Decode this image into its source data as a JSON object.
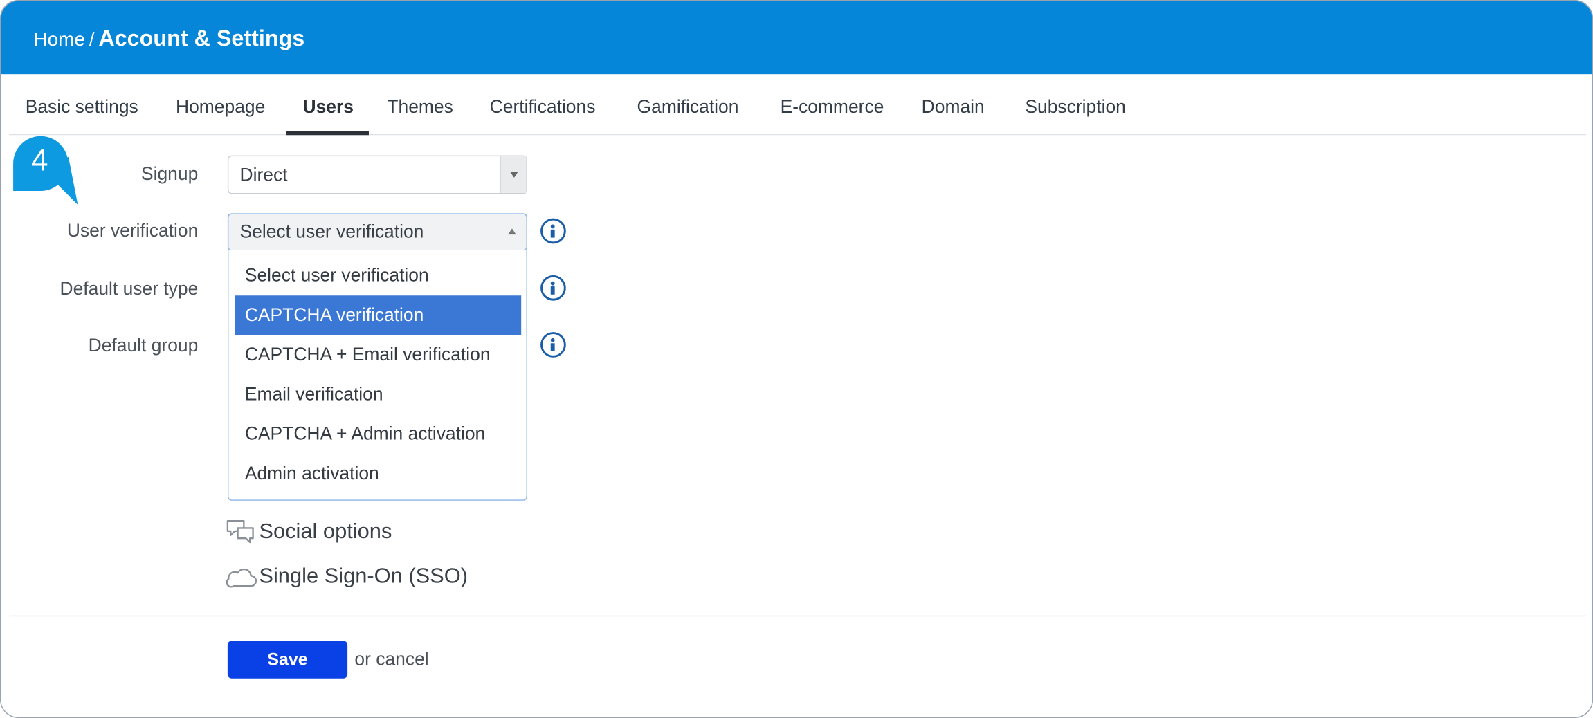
{
  "header": {
    "breadcrumb_home": "Home",
    "breadcrumb_sep": "/",
    "title": "Account & Settings",
    "bg_color": "#0686d8"
  },
  "tabs": [
    {
      "label": "Basic settings"
    },
    {
      "label": "Homepage"
    },
    {
      "label": "Users",
      "active": true
    },
    {
      "label": "Themes"
    },
    {
      "label": "Certifications"
    },
    {
      "label": "Gamification"
    },
    {
      "label": "E-commerce"
    },
    {
      "label": "Domain"
    },
    {
      "label": "Subscription"
    }
  ],
  "step_badge": {
    "number": "4",
    "color": "#0e9ae0"
  },
  "form": {
    "signup": {
      "label": "Signup",
      "value": "Direct"
    },
    "user_verification": {
      "label": "User verification",
      "value": "Select user verification",
      "options": [
        "Select user verification",
        "CAPTCHA verification",
        "CAPTCHA + Email verification",
        "Email verification",
        "CAPTCHA + Admin activation",
        "Admin activation"
      ],
      "highlighted": "CAPTCHA verification",
      "highlight_color": "#3b78d6"
    },
    "default_user_type": {
      "label": "Default user type"
    },
    "default_group": {
      "label": "Default group"
    }
  },
  "sections": {
    "social": {
      "label": "Social options",
      "icon": "chat-bubbles-icon"
    },
    "sso": {
      "label": "Single Sign-On (SSO)",
      "icon": "cloud-icon"
    }
  },
  "actions": {
    "save_label": "Save",
    "save_color": "#0a41e6",
    "cancel_text": "or cancel"
  }
}
